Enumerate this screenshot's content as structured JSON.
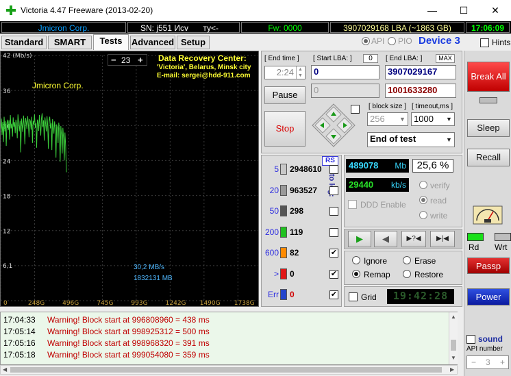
{
  "window": {
    "title": "Victoria 4.47  Freeware (2013-02-20)",
    "minimize_glyph": "—",
    "maximize_glyph": "☐",
    "close_glyph": "✕"
  },
  "info": {
    "vendor": "Jmicron Corp.",
    "serial": "SN: j551 Исv",
    "model": "ту<-",
    "firmware": "Fw: 0000",
    "capacity": "3907029168 LBA (~1863 GB)",
    "clock": "17:06:09"
  },
  "api": {
    "api_label": "API",
    "pio_label": "PIO",
    "device": "Device 3",
    "hints": "Hints"
  },
  "tabs": [
    "Standard",
    "SMART",
    "Tests",
    "Advanced",
    "Setup"
  ],
  "graph": {
    "title": "Data Recovery Center:",
    "line1": "'Victoria', Belarus, Minsk city",
    "line2": "E-mail: sergei@hdd-911.com",
    "vendor": "Jmicron Corp.",
    "zoom_minus": "−",
    "zoom_value": "23",
    "zoom_plus": "+",
    "speed": "30,2 MB/s",
    "position": "1832131 MB",
    "y_unit": "42 (Mb/s)",
    "y_ticks": [
      "36",
      "30",
      "24",
      "18",
      "12",
      "6,1"
    ],
    "x_ticks": [
      "0",
      "248G",
      "496G",
      "745G",
      "993G",
      "1242G",
      "1490G",
      "1738G"
    ]
  },
  "chart_data": {
    "type": "line",
    "title": "",
    "xlabel": "",
    "ylabel": "(Mb/s)",
    "xlim": [
      0,
      1863
    ],
    "ylim": [
      0,
      42
    ],
    "grid": true,
    "x": [
      0,
      5,
      10,
      15,
      20,
      25,
      30,
      35,
      40,
      45,
      50,
      55,
      60,
      65,
      70,
      75,
      80,
      85,
      90,
      95,
      100,
      105,
      110,
      115,
      120,
      125,
      130,
      135,
      140,
      145,
      150,
      155,
      160,
      165,
      170,
      175,
      180,
      185,
      190,
      195,
      200,
      205,
      210,
      215,
      220,
      225,
      230,
      235,
      240,
      245,
      250,
      255,
      260,
      265,
      270,
      275,
      280,
      285,
      290,
      295,
      300,
      305,
      310,
      315,
      320,
      325,
      330,
      335,
      340,
      345,
      350,
      355,
      360,
      365,
      370,
      375,
      380,
      385,
      390,
      395,
      400,
      405,
      410,
      415,
      420,
      425,
      430,
      435,
      440,
      445,
      450,
      455,
      460,
      465,
      470,
      475
    ],
    "series": [
      {
        "values": [
          29.5,
          31.2,
          28.4,
          30.6,
          27.2,
          31.5,
          29.0,
          30.8,
          26.5,
          30.4,
          31.0,
          29.2,
          30.9,
          27.6,
          31.8,
          29.5,
          30.3,
          28.1,
          31.4,
          29.8,
          30.6,
          28.7,
          31.0,
          30.2,
          27.8,
          31.9,
          30.5,
          29.0,
          30.8,
          25.4,
          31.2,
          30.1,
          28.9,
          31.7,
          30.0,
          26.8,
          31.3,
          30.6,
          29.4,
          31.6,
          30.2,
          28.0,
          31.1,
          30.7,
          29.3,
          31.5,
          27.0,
          30.8,
          30.2,
          31.9,
          29.6,
          30.4,
          26.2,
          31.0,
          30.5,
          29.1,
          31.8,
          30.0,
          28.3,
          31.2,
          32.1,
          29.7,
          30.9,
          27.4,
          31.4,
          30.3,
          29.0,
          31.6,
          30.1,
          26.0,
          30.8,
          31.5,
          29.5,
          30.4,
          25.8,
          31.1,
          30.0,
          28.6,
          30.7,
          29.4,
          24.5,
          30.2,
          29.6,
          27.0,
          30.5,
          29.0,
          23.8,
          29.9,
          28.4,
          25.2,
          29.6,
          27.8,
          24.0,
          28.8,
          26.4,
          22.0
        ]
      }
    ]
  },
  "controls": {
    "end_time_label": "[ End time ]",
    "end_time_value": "2:24",
    "start_lba_label": "[ Start LBA: ]",
    "start_lba_zero": "0",
    "start_lba_value": "0",
    "end_lba_label": "[ End LBA: ]",
    "end_lba_max": "MAX",
    "end_lba_value": "3907029167",
    "lba_current_value": "0",
    "lba_pos_value": "1001633280",
    "pause": "Pause",
    "stop": "Stop",
    "block_size_label": "[ block size ]",
    "block_size_value": "256",
    "timeout_label": "[ timeout,ms ]",
    "timeout_value": "1000",
    "end_action": "End of test"
  },
  "counters": {
    "rs": "RS",
    "to_log": "to log:",
    "rows": [
      {
        "label": "5",
        "color": "#c8c8c8",
        "value": "2948610",
        "checked": false
      },
      {
        "label": "20",
        "color": "#9a9a9a",
        "value": "963527",
        "checked": false
      },
      {
        "label": "50",
        "color": "#555555",
        "value": "298",
        "checked": false
      },
      {
        "label": "200",
        "color": "#21c121",
        "value": "119",
        "checked": false
      },
      {
        "label": "600",
        "color": "#ff8a00",
        "value": "82",
        "checked": true
      },
      {
        "label": ">",
        "color": "#e01616",
        "value": "0",
        "checked": true
      },
      {
        "label": "Err",
        "color": "#2244cc",
        "value": "0",
        "checked": true
      }
    ]
  },
  "status": {
    "mb_value": "489078",
    "mb_unit": "Mb",
    "percent": "25,6 %",
    "speed_value": "29440",
    "speed_unit": "kb/s",
    "verify": "verify",
    "read": "read",
    "write": "write",
    "ddd": "DDD Enable",
    "play_icon": "▶",
    "back_icon": "◀",
    "unknown_icon": "▶?◀",
    "end_icon": "▶|◀",
    "ignore": "Ignore",
    "erase": "Erase",
    "remap": "Remap",
    "restore": "Restore",
    "grid": "Grid",
    "timer": "19:42:28"
  },
  "log": [
    {
      "time": "17:04:33",
      "msg": "Warning! Block start at 996808960 = 438 ms"
    },
    {
      "time": "17:05:14",
      "msg": "Warning! Block start at 998925312 = 500 ms"
    },
    {
      "time": "17:05:16",
      "msg": "Warning! Block start at 998968320 = 391 ms"
    },
    {
      "time": "17:05:18",
      "msg": "Warning! Block start at 999054080 = 359 ms"
    }
  ],
  "right": {
    "break_all": "Break All",
    "sleep": "Sleep",
    "recall": "Recall",
    "rd": "Rd",
    "wrt": "Wrt",
    "passp": "Passp",
    "power": "Power",
    "sound": "sound",
    "api_number": "API number",
    "api_minus": "−",
    "api_value": "3",
    "api_plus": "+"
  },
  "colors": {
    "info_vendor": "#0aa0ff",
    "info_fw": "#00ff00",
    "info_capacity": "#ffff99",
    "graph_line": "#3cd03c",
    "graph_title": "#ffff33",
    "graph_sub": "#ffff33",
    "graph_speed": "#4fb8ff",
    "stop_red": "#d80000",
    "break_red": "#e01010",
    "power_blue": "#1030c0",
    "log_red": "#c00000",
    "lcd_cyan": "#38d8ff",
    "lcd_green": "#28e028"
  }
}
